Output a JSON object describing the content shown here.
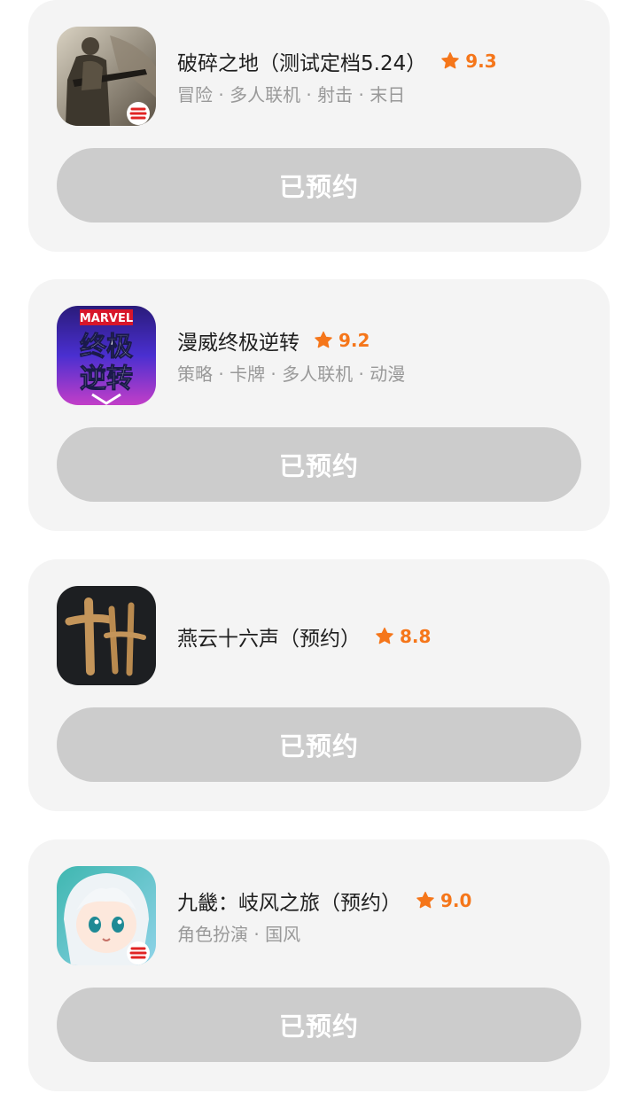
{
  "games": [
    {
      "title": "破碎之地（测试定档5.24）",
      "rating": "9.3",
      "tags": "冒险 · 多人联机 · 射击 · 末日",
      "button_label": "已预约",
      "icon": "soldier-game-icon",
      "icon_badge": "netease-logo"
    },
    {
      "title": "漫威终极逆转",
      "rating": "9.2",
      "tags": "策略 · 卡牌 · 多人联机 · 动漫",
      "button_label": "已预约",
      "icon": "marvel-game-icon",
      "icon_text_top": "MARVEL",
      "icon_text_main_1": "终极",
      "icon_text_main_2": "逆转"
    },
    {
      "title": "燕云十六声（预约）",
      "rating": "8.8",
      "tags": "",
      "button_label": "已预约",
      "icon": "calligraphy-game-icon"
    },
    {
      "title": "九畿：岐风之旅（预约）",
      "rating": "9.0",
      "tags": "角色扮演 · 国风",
      "button_label": "已预约",
      "icon": "anime-girl-game-icon",
      "icon_badge": "netease-logo"
    }
  ],
  "colors": {
    "card_bg": "#f4f4f4",
    "button_bg": "#cccccc",
    "rating": "#f5761a",
    "tags": "#999999"
  }
}
